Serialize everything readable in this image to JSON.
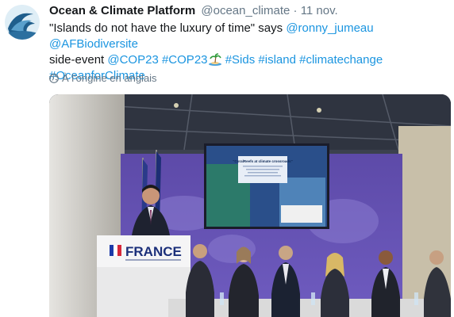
{
  "tweet": {
    "author_name": "Ocean & Climate Platform",
    "handle": "@ocean_climate",
    "separator": "·",
    "timestamp": "11 nov.",
    "text": {
      "quote": "\"Islands do not have the luxury of time\" says ",
      "mention1": "@ronny_jumeau",
      "mention2": "@AFBiodiversite",
      "mid": "side-event ",
      "hashtag1": "@COP23",
      "hashtag2": "#COP23",
      "hashtag3": "#Sids",
      "hashtag4": "#island",
      "hashtag5": "#climatechange",
      "hashtag6": "#OceanforClimate"
    },
    "translate_label": "À l'origine en anglais"
  },
  "photo": {
    "podium_text": "FRANCE",
    "screen_title": "\"CoralReefs at climate crossroads\""
  },
  "colors": {
    "link": "#1b95e0",
    "secondary": "#657786",
    "text": "#14171a"
  },
  "icons": [
    "globe-icon",
    "island-emoji-icon"
  ]
}
